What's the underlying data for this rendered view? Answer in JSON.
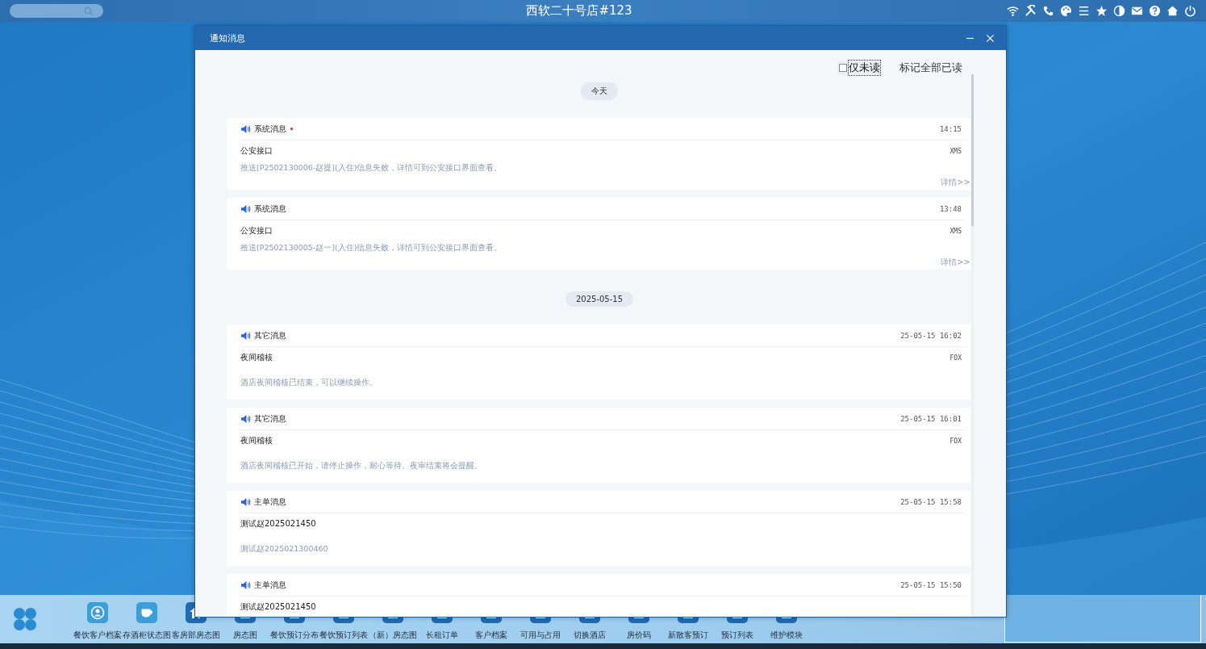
{
  "top_bar": {
    "title": "西软二十号店#123"
  },
  "dialog": {
    "title": "通知消息",
    "unread_only": {
      "label": "仅未读",
      "checked": false
    },
    "mark_all_read": "标记全部已读",
    "groups": [
      {
        "date": "今天",
        "messages": [
          {
            "category": "系统消息",
            "unread": true,
            "time": "14:15",
            "title": "公安接口",
            "source": "XMS",
            "body": "推送[P2502130006-赵提](入住)信息失败，详情可到公安接口界面查看。",
            "details": "详情>>"
          },
          {
            "category": "系统消息",
            "unread": false,
            "time": "13:48",
            "title": "公安接口",
            "source": "XMS",
            "body": "推送[P2502130005-赵一](入住)信息失败，详情可到公安接口界面查看。",
            "details": "详情>>"
          }
        ]
      },
      {
        "date": "2025-05-15",
        "messages": [
          {
            "category": "其它消息",
            "unread": false,
            "time": "25-05-15 16:02",
            "title": "夜间稽核",
            "source": "FOX",
            "body": "酒店夜间稽核已结束，可以继续操作。"
          },
          {
            "category": "其它消息",
            "unread": false,
            "time": "25-05-15 16:01",
            "title": "夜间稽核",
            "source": "FOX",
            "body": "酒店夜间稽核已开始，请停止操作，耐心等待。夜审结束将会提醒。"
          },
          {
            "category": "主单消息",
            "unread": false,
            "time": "25-05-15 15:58",
            "title": "测试赵2025021450",
            "body": "测试赵2025021300460"
          },
          {
            "category": "主单消息",
            "unread": false,
            "time": "25-05-15 15:50",
            "title": "测试赵2025021450"
          }
        ]
      }
    ]
  },
  "taskbar": {
    "items": [
      {
        "label": "餐饮客户档案",
        "kind": "user"
      },
      {
        "label": "存酒柜状态图",
        "kind": "cup"
      },
      {
        "label": "客房部房态图",
        "kind": "house"
      },
      {
        "label": "房态图",
        "kind": "app"
      },
      {
        "label": "餐饮预订分布",
        "kind": "app"
      },
      {
        "label": "餐饮预订列表",
        "kind": "app"
      },
      {
        "label": "（新）房态图",
        "kind": "app"
      },
      {
        "label": "长租订单",
        "kind": "app"
      },
      {
        "label": "客户档案",
        "kind": "app"
      },
      {
        "label": "可用与占用",
        "kind": "app"
      },
      {
        "label": "切换酒店",
        "kind": "app"
      },
      {
        "label": "房价码",
        "kind": "app"
      },
      {
        "label": "新散客预订",
        "kind": "app"
      },
      {
        "label": "预订列表",
        "kind": "app"
      },
      {
        "label": "维护模块",
        "kind": "app"
      }
    ]
  }
}
